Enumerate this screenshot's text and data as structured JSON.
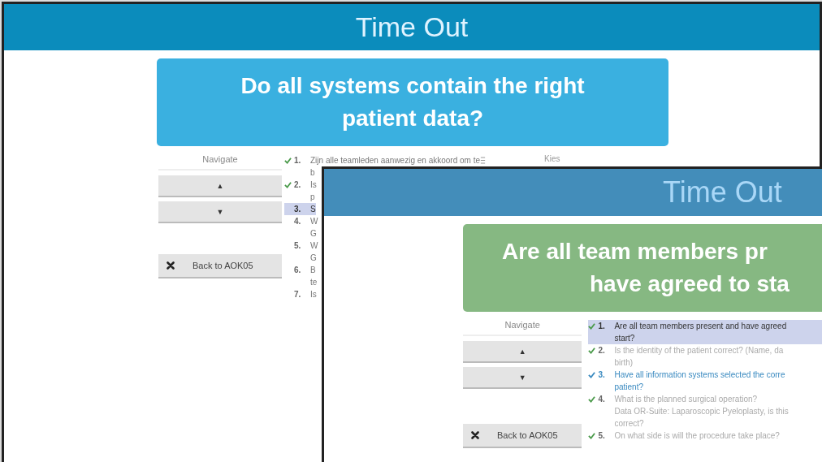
{
  "windows": [
    {
      "title": "Time Out",
      "question": [
        "Do all systems contain the right",
        "patient data?"
      ],
      "navigate": "Navigate",
      "up": "▲",
      "down": "▼",
      "back": "Back to AOK05",
      "column_text": "Kies",
      "items": [
        {
          "number": "1.",
          "lines": [
            "Zijn alle teamleden aanwezig en akkoord om te",
            "b"
          ],
          "checked": true,
          "selected": false,
          "current": false
        },
        {
          "number": "2.",
          "lines": [
            "Is",
            "p"
          ],
          "checked": true,
          "selected": false,
          "current": false
        },
        {
          "number": "3.",
          "lines": [
            "S"
          ],
          "checked": false,
          "selected": true,
          "current": false
        },
        {
          "number": "4.",
          "lines": [
            "W",
            "G"
          ],
          "checked": false,
          "selected": false,
          "current": false
        },
        {
          "number": "5.",
          "lines": [
            "W",
            "G"
          ],
          "checked": false,
          "selected": false,
          "current": false
        },
        {
          "number": "6.",
          "lines": [
            "B",
            "te"
          ],
          "checked": false,
          "selected": false,
          "current": false
        },
        {
          "number": "7.",
          "lines": [
            "Is"
          ],
          "checked": false,
          "selected": false,
          "current": false
        }
      ]
    },
    {
      "title": "Time Out",
      "question": [
        "Are all team members pr",
        "have agreed to sta"
      ],
      "navigate": "Navigate",
      "up": "▲",
      "down": "▼",
      "back": "Back to AOK05",
      "items": [
        {
          "number": "1.",
          "lines": [
            "Are all team members present and have agreed",
            "start?"
          ],
          "checked": true,
          "selected": true,
          "current": false
        },
        {
          "number": "2.",
          "lines": [
            "Is the identity of the patient correct? (Name, da",
            "birth)"
          ],
          "checked": true,
          "selected": false,
          "current": false
        },
        {
          "number": "3.",
          "lines": [
            "Have all information systems selected the corre",
            "patient?"
          ],
          "checked": true,
          "selected": false,
          "current": true
        },
        {
          "number": "4.",
          "lines": [
            "What is the planned surgical operation?",
            "Data OR-Suite: Laparoscopic Pyeloplasty, is this",
            "correct?"
          ],
          "checked": true,
          "selected": false,
          "current": false
        },
        {
          "number": "5.",
          "lines": [
            "On what side is will the procedure take place?"
          ],
          "checked": true,
          "selected": false,
          "current": false
        }
      ]
    }
  ]
}
